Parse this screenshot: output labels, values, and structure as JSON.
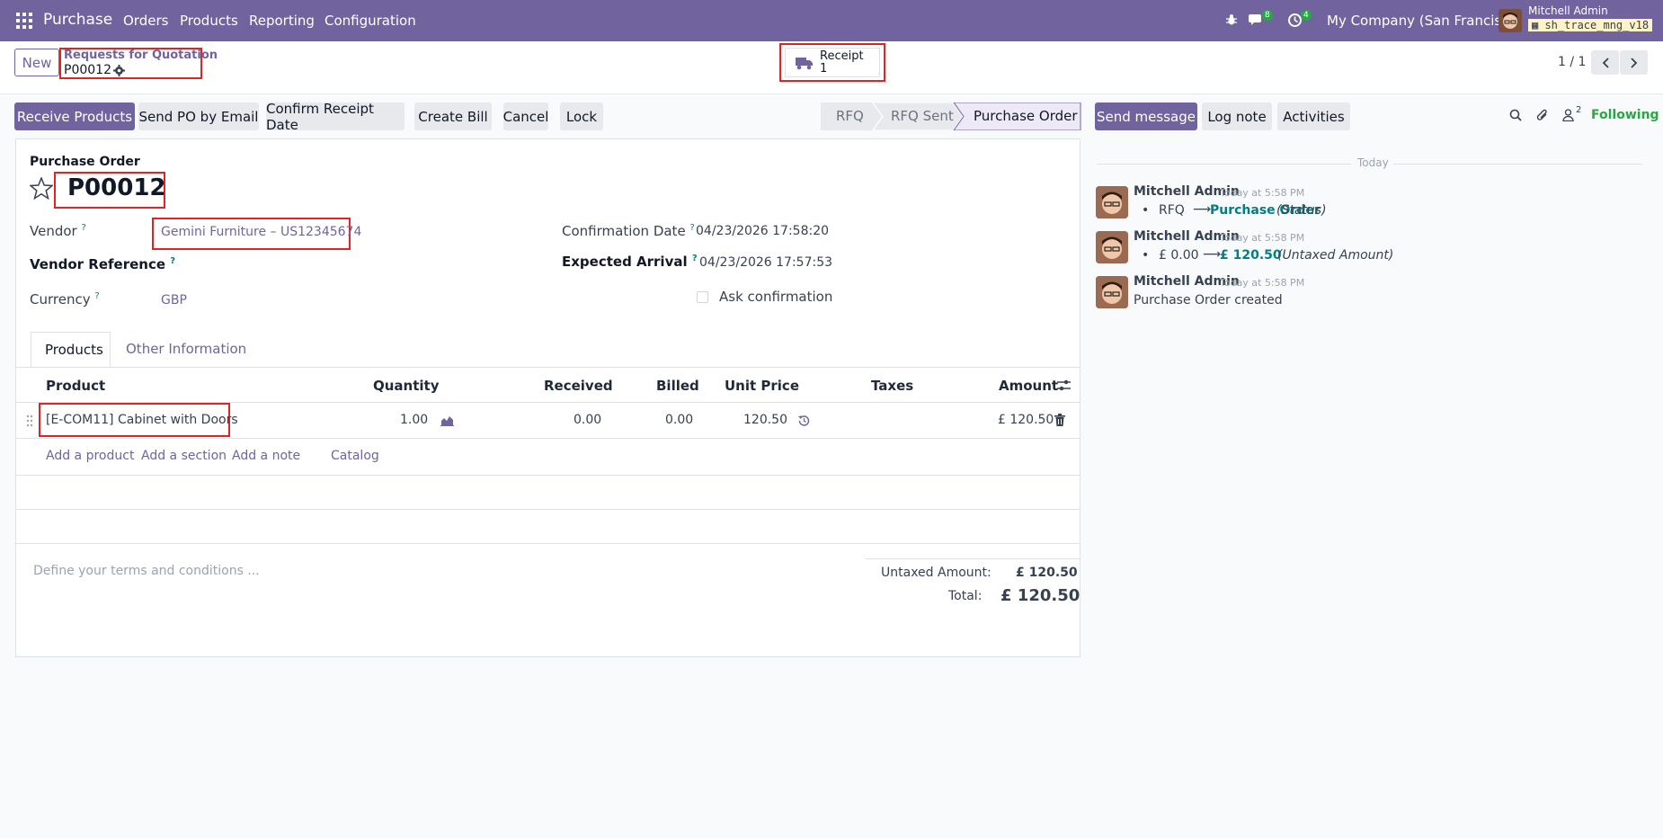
{
  "navbar": {
    "app_name": "Purchase",
    "menus": [
      "Orders",
      "Products",
      "Reporting",
      "Configuration"
    ],
    "messages_count": "8",
    "activities_count": "4",
    "company": "My Company (San Francisco)",
    "user_name": "Mitchell Admin",
    "db_name": "sh_trace_mng_v18"
  },
  "control_panel": {
    "new_label": "New",
    "breadcrumb_parent": "Requests for Quotation",
    "breadcrumb_current": "P00012",
    "receipt_label": "Receipt",
    "receipt_count": "1",
    "pager": "1 / 1"
  },
  "actions": {
    "receive_products": "Receive Products",
    "send_po_email": "Send PO by Email",
    "confirm_receipt_date": "Confirm Receipt Date",
    "create_bill": "Create Bill",
    "cancel": "Cancel",
    "lock": "Lock"
  },
  "status": {
    "stages": [
      "RFQ",
      "RFQ Sent",
      "Purchase Order"
    ],
    "active": "Purchase Order"
  },
  "form": {
    "title_label": "Purchase Order",
    "name": "P00012",
    "vendor_label": "Vendor",
    "vendor_value": "Gemini Furniture – US12345674",
    "vendor_reference_label": "Vendor Reference",
    "currency_label": "Currency",
    "currency_value": "GBP",
    "confirmation_date_label": "Confirmation Date",
    "confirmation_date_value": "04/23/2026 17:58:20",
    "expected_arrival_label": "Expected Arrival",
    "expected_arrival_value": "04/23/2026 17:57:53",
    "ask_confirmation_label": "Ask confirmation",
    "help_mark": "?"
  },
  "tabs": [
    "Products",
    "Other Information"
  ],
  "lines": {
    "headers": {
      "product": "Product",
      "quantity": "Quantity",
      "received": "Received",
      "billed": "Billed",
      "unit_price": "Unit Price",
      "taxes": "Taxes",
      "amount": "Amount"
    },
    "rows": [
      {
        "product": "[E-COM11] Cabinet with Doors",
        "quantity": "1.00",
        "received": "0.00",
        "billed": "0.00",
        "unit_price": "120.50",
        "taxes": "",
        "amount": "£ 120.50"
      }
    ],
    "add_product": "Add a product",
    "add_section": "Add a section",
    "add_note": "Add a note",
    "catalog": "Catalog"
  },
  "terms_placeholder": "Define your terms and conditions ...",
  "totals": {
    "untaxed_label": "Untaxed Amount:",
    "untaxed_value": "£ 120.50",
    "total_label": "Total:",
    "total_value": "£ 120.50"
  },
  "chatter": {
    "send_message": "Send message",
    "log_note": "Log note",
    "activities": "Activities",
    "followers_count": "2",
    "following": "Following",
    "date_separator": "Today",
    "messages": [
      {
        "author": "Mitchell Admin",
        "time": "Today at 5:58 PM",
        "old": "RFQ",
        "new": "Purchase Order",
        "field": "(Status)"
      },
      {
        "author": "Mitchell Admin",
        "time": "Today at 5:58 PM",
        "old": "£ 0.00",
        "new": "£ 120.50",
        "field": "(Untaxed Amount)"
      },
      {
        "author": "Mitchell Admin",
        "time": "Today at 5:58 PM",
        "body": "Purchase Order created"
      }
    ]
  },
  "colors": {
    "brand": "#71639e",
    "link_teal": "#017e84",
    "following_green": "#28a745",
    "highlight_red": "#e02424"
  }
}
